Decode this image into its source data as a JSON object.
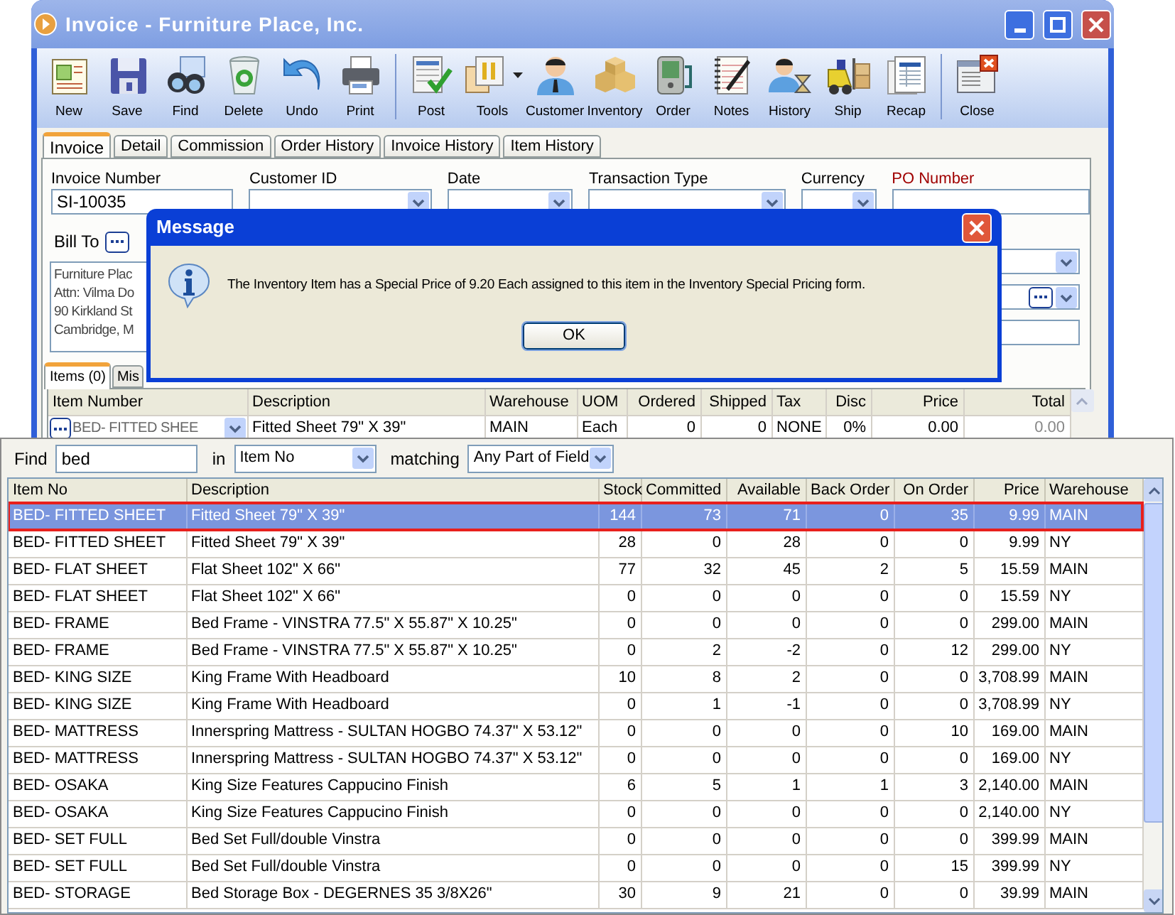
{
  "window": {
    "title": "Invoice - Furniture Place, Inc."
  },
  "toolbar": [
    {
      "buttons": [
        {
          "label": "New",
          "kind": "new",
          "menu": false
        },
        {
          "label": "Save",
          "kind": "save",
          "menu": false
        },
        {
          "label": "Find",
          "kind": "find",
          "menu": false
        },
        {
          "label": "Delete",
          "kind": "delete",
          "menu": false
        },
        {
          "label": "Undo",
          "kind": "undo",
          "menu": false
        },
        {
          "label": "Print",
          "kind": "print",
          "menu": false
        }
      ]
    },
    {
      "buttons": [
        {
          "label": "Post",
          "kind": "post",
          "menu": false
        },
        {
          "label": "Tools",
          "kind": "tools",
          "menu": true
        },
        {
          "label": "Customer",
          "kind": "customer",
          "menu": false
        },
        {
          "label": "Inventory",
          "kind": "inventory",
          "menu": false
        },
        {
          "label": "Order",
          "kind": "order",
          "menu": false
        },
        {
          "label": "Notes",
          "kind": "notes",
          "menu": false
        },
        {
          "label": "History",
          "kind": "history",
          "menu": false
        },
        {
          "label": "Ship",
          "kind": "ship",
          "menu": false
        },
        {
          "label": "Recap",
          "kind": "recap",
          "menu": false
        }
      ]
    },
    {
      "buttons": [
        {
          "label": "Close",
          "kind": "close",
          "menu": false
        }
      ]
    }
  ],
  "tabs": [
    {
      "label": "Invoice",
      "selected": true
    },
    {
      "label": "Detail",
      "selected": false
    },
    {
      "label": "Commission",
      "selected": false
    },
    {
      "label": "Order History",
      "selected": false
    },
    {
      "label": "Invoice History",
      "selected": false
    },
    {
      "label": "Item History",
      "selected": false
    }
  ],
  "fields": [
    {
      "label": "Invoice Number",
      "kind": "text",
      "value": "SI-10035",
      "required": false
    },
    {
      "label": "Customer ID",
      "kind": "combo",
      "required": false
    },
    {
      "label": "Date",
      "kind": "combo",
      "required": false
    },
    {
      "label": "Transaction Type",
      "kind": "combo",
      "required": false
    },
    {
      "label": "Currency",
      "kind": "combo",
      "required": false
    },
    {
      "label": "PO Number",
      "kind": "text",
      "required": true
    }
  ],
  "bill_to": {
    "label": "Bill To",
    "lines": [
      "Furniture Plac",
      "Attn: Vilma Do",
      "90 Kirkland St",
      "Cambridge, M"
    ]
  },
  "side_fields": [
    {
      "kind": "combo"
    },
    {
      "kind": "lookup"
    },
    {
      "kind": "text"
    }
  ],
  "detail_tabs": [
    {
      "label": "Items (0)",
      "selected": true
    },
    {
      "label": "Mis",
      "selected": false
    }
  ],
  "items": {
    "columns": [
      "Item Number",
      "Description",
      "Warehouse",
      "UOM",
      "Ordered",
      "Shipped",
      "Tax",
      "Disc",
      "Price",
      "Total"
    ],
    "rows": [
      {
        "cells": [
          "BED- FITTED SHEE",
          "Fitted Sheet 79\" X 39\"",
          "MAIN",
          "Each",
          "0",
          "0",
          "NONE",
          "0%",
          "0.00",
          "0.00"
        ]
      }
    ]
  },
  "dialog": {
    "title": "Message",
    "message": "The Inventory Item has a Special Price of 9.20 Each assigned to this item in the Inventory Special Pricing form.",
    "buttons": [
      "OK"
    ]
  },
  "lookup": {
    "find_label": "Find",
    "find_value": "bed",
    "in_label": "in",
    "in_value": "Item No",
    "matching_label": "matching",
    "matching_value": "Any Part of Field",
    "columns": [
      "Item No",
      "Description",
      "Stock",
      "Committed",
      "Available",
      "Back Order",
      "On Order",
      "Price",
      "Warehouse"
    ],
    "rows": [
      {
        "selected": true,
        "cells": [
          "BED- FITTED SHEET",
          "Fitted Sheet 79\" X 39\"",
          "144",
          "73",
          "71",
          "0",
          "35",
          "9.99",
          "MAIN"
        ]
      },
      {
        "selected": false,
        "cells": [
          "BED- FITTED SHEET",
          "Fitted Sheet 79\" X 39\"",
          "28",
          "0",
          "28",
          "0",
          "0",
          "9.99",
          "NY"
        ]
      },
      {
        "selected": false,
        "cells": [
          "BED- FLAT SHEET",
          "Flat Sheet 102\" X 66\"",
          "77",
          "32",
          "45",
          "2",
          "5",
          "15.59",
          "MAIN"
        ]
      },
      {
        "selected": false,
        "cells": [
          "BED- FLAT SHEET",
          "Flat Sheet 102\" X 66\"",
          "0",
          "0",
          "0",
          "0",
          "0",
          "15.59",
          "NY"
        ]
      },
      {
        "selected": false,
        "cells": [
          "BED- FRAME",
          "Bed Frame - VINSTRA 77.5\" X 55.87\" X 10.25\"",
          "0",
          "0",
          "0",
          "0",
          "0",
          "299.00",
          "MAIN"
        ]
      },
      {
        "selected": false,
        "cells": [
          "BED- FRAME",
          "Bed Frame - VINSTRA 77.5\" X 55.87\" X 10.25\"",
          "0",
          "2",
          "-2",
          "0",
          "12",
          "299.00",
          "NY"
        ]
      },
      {
        "selected": false,
        "cells": [
          "BED- KING SIZE",
          "King Frame With Headboard",
          "10",
          "8",
          "2",
          "0",
          "0",
          "3,708.99",
          "MAIN"
        ]
      },
      {
        "selected": false,
        "cells": [
          "BED- KING SIZE",
          "King Frame With Headboard",
          "0",
          "1",
          "-1",
          "0",
          "0",
          "3,708.99",
          "NY"
        ]
      },
      {
        "selected": false,
        "cells": [
          "BED- MATTRESS",
          "Innerspring Mattress - SULTAN HOGBO 74.37\" X 53.12\"",
          "0",
          "0",
          "0",
          "0",
          "10",
          "169.00",
          "MAIN"
        ]
      },
      {
        "selected": false,
        "cells": [
          "BED- MATTRESS",
          "Innerspring Mattress - SULTAN HOGBO 74.37\" X 53.12\"",
          "0",
          "0",
          "0",
          "0",
          "0",
          "169.00",
          "NY"
        ]
      },
      {
        "selected": false,
        "cells": [
          "BED- OSAKA",
          "King Size Features Cappucino Finish",
          "6",
          "5",
          "1",
          "1",
          "3",
          "2,140.00",
          "MAIN"
        ]
      },
      {
        "selected": false,
        "cells": [
          "BED- OSAKA",
          "King Size Features Cappucino Finish",
          "0",
          "0",
          "0",
          "0",
          "0",
          "2,140.00",
          "NY"
        ]
      },
      {
        "selected": false,
        "cells": [
          "BED- SET FULL",
          "Bed Set Full/double Vinstra",
          "0",
          "0",
          "0",
          "0",
          "0",
          "399.99",
          "MAIN"
        ]
      },
      {
        "selected": false,
        "cells": [
          "BED- SET FULL",
          "Bed Set Full/double Vinstra",
          "0",
          "0",
          "0",
          "0",
          "15",
          "399.99",
          "NY"
        ]
      },
      {
        "selected": false,
        "cells": [
          "BED- STORAGE",
          "Bed Storage Box - DEGERNES 35 3/8X26\"",
          "30",
          "9",
          "21",
          "0",
          "0",
          "39.99",
          "MAIN"
        ]
      }
    ]
  }
}
